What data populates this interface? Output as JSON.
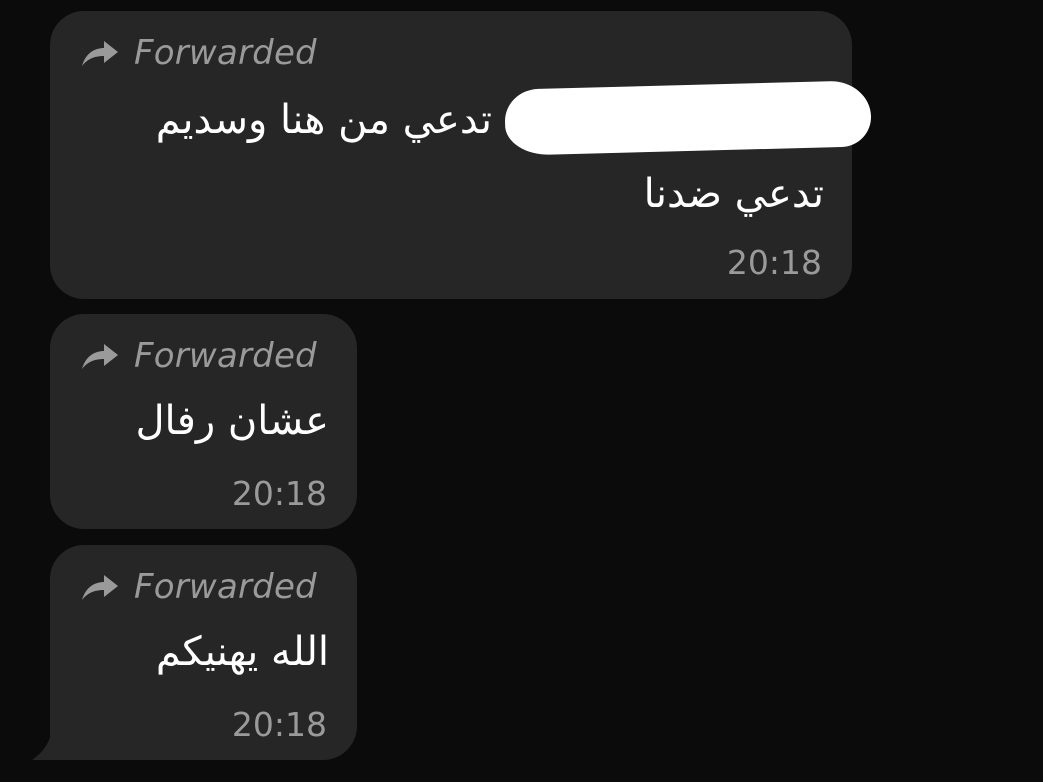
{
  "messages": [
    {
      "forwarded_label": "Forwarded",
      "lines": [
        "تدعي من هنا وسديم",
        "تدعي ضدنا"
      ],
      "time": "20:18",
      "has_redaction": true
    },
    {
      "forwarded_label": "Forwarded",
      "lines": [
        "عشان رفال"
      ],
      "time": "20:18"
    },
    {
      "forwarded_label": "Forwarded",
      "lines": [
        "الله يهنيكم"
      ],
      "time": "20:18"
    }
  ],
  "icons": {
    "forward": "forward-arrow-icon"
  },
  "colors": {
    "background": "#0b0b0b",
    "bubble": "#262626",
    "text": "#ffffff",
    "meta": "#9a9a9a",
    "redaction": "#ffffff"
  }
}
